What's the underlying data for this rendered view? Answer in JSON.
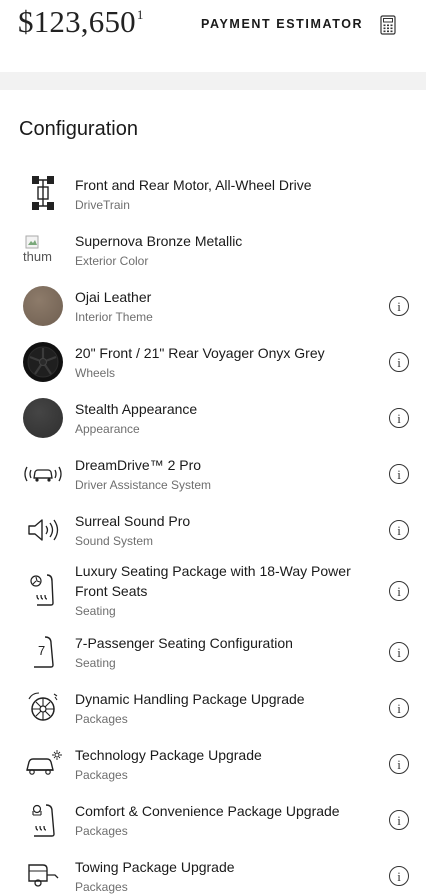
{
  "header": {
    "price": "$123,650",
    "price_footnote": "1",
    "estimator_label": "PAYMENT ESTIMATOR",
    "calculator_icon": "calculator-icon"
  },
  "section_title": "Configuration",
  "items": [
    {
      "title": "Front and Rear Motor, All-Wheel Drive",
      "subtitle": "DriveTrain",
      "icon": "drivetrain-icon"
    },
    {
      "title": "Supernova Bronze Metallic",
      "subtitle": "Exterior Color",
      "thumb_alt": "thum"
    },
    {
      "title": "Ojai Leather",
      "subtitle": "Interior Theme",
      "swatch_color": "#7c6b5c"
    },
    {
      "title": "20\" Front / 21\" Rear Voyager Onyx Grey",
      "subtitle": "Wheels",
      "icon": "wheel-icon"
    },
    {
      "title": "Stealth Appearance",
      "subtitle": "Appearance",
      "swatch_color": "#3a3a3a"
    },
    {
      "title": "DreamDrive™ 2 Pro",
      "subtitle": "Driver Assistance System",
      "icon": "car-sensor-icon"
    },
    {
      "title": "Surreal Sound Pro",
      "subtitle": "Sound System",
      "icon": "speaker-icon"
    },
    {
      "title": "Luxury Seating Package with 18-Way Power Front Seats",
      "subtitle": "Seating",
      "icon": "seat-climate-icon"
    },
    {
      "title": "7-Passenger Seating Configuration",
      "subtitle": "Seating",
      "icon": "seat-seven-icon",
      "seat_number": "7"
    },
    {
      "title": "Dynamic Handling Package Upgrade",
      "subtitle": "Packages",
      "icon": "handling-icon"
    },
    {
      "title": "Technology Package Upgrade",
      "subtitle": "Packages",
      "icon": "tech-car-icon"
    },
    {
      "title": "Comfort & Convenience Package Upgrade",
      "subtitle": "Packages",
      "icon": "comfort-seat-icon"
    },
    {
      "title": "Towing Package Upgrade",
      "subtitle": "Packages",
      "icon": "towing-icon"
    }
  ],
  "info_glyph": "i"
}
